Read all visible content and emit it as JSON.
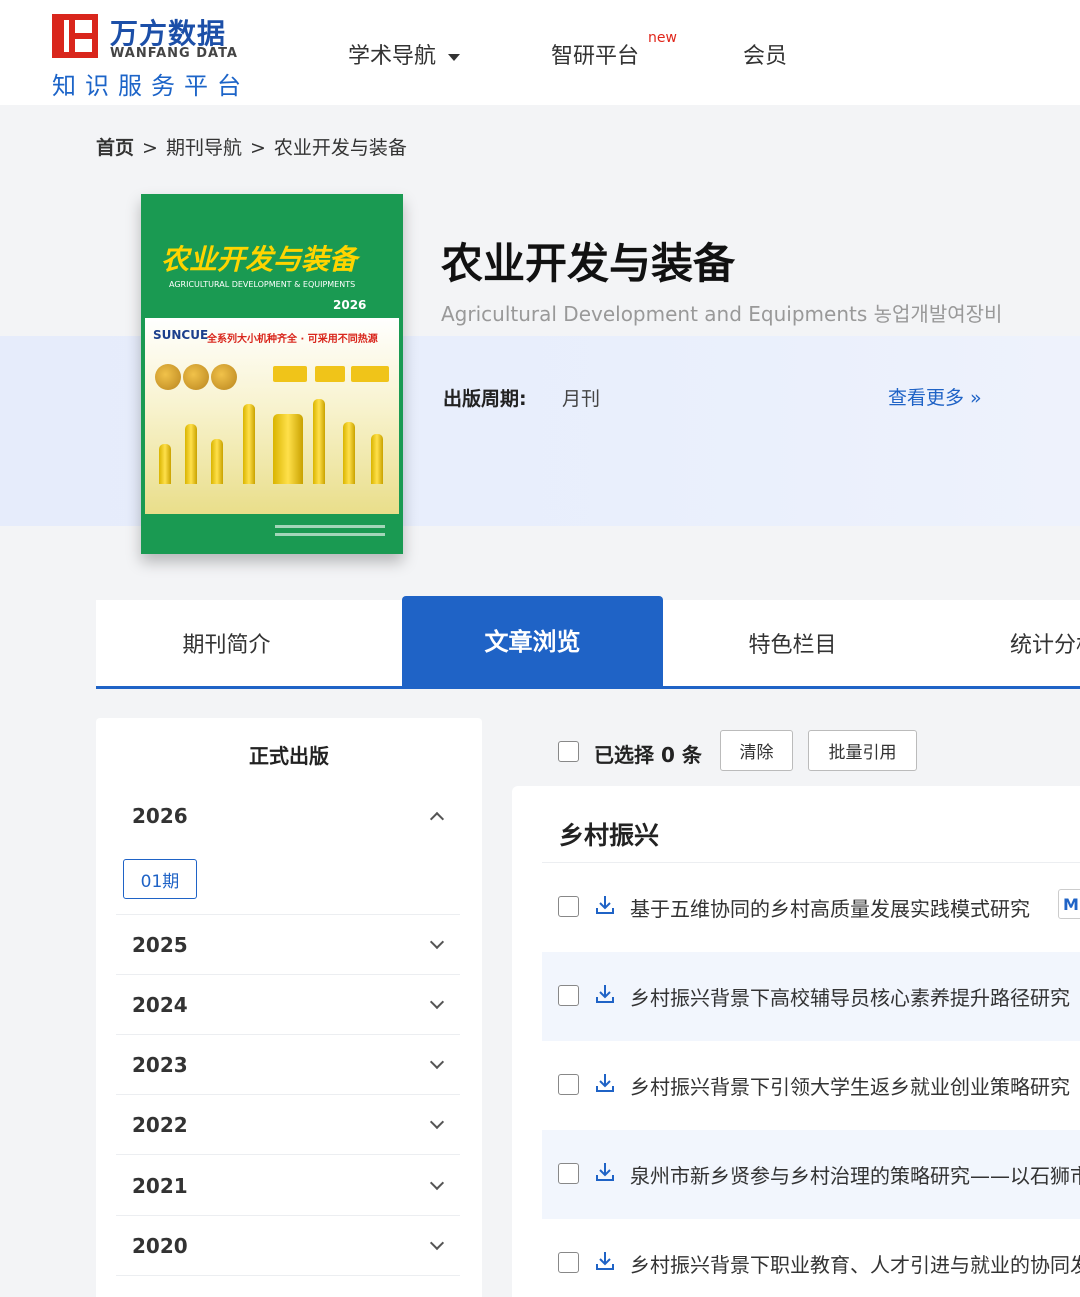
{
  "header": {
    "logo_cn": "万方数据",
    "logo_en": "WANFANG DATA",
    "logo_sub": "知识服务平台",
    "nav": [
      {
        "label": "学术导航"
      },
      {
        "label": "智研平台",
        "badge": "new"
      },
      {
        "label": "会员"
      }
    ]
  },
  "breadcrumb": {
    "home": "首页",
    "sep": ">",
    "level1": "期刊导航",
    "level2": "农业开发与装备"
  },
  "cover": {
    "title": "农业开发与装备",
    "en": "AGRICULTURAL DEVELOPMENT & EQUIPMENTS",
    "year": "2026",
    "brand": "SUNCUE",
    "slogan": "全系列大小机种齐全 · 可采用不同热源"
  },
  "journal": {
    "title": "农业开发与装备",
    "subtitle": "Agricultural Development and Equipments 농업개발여장비",
    "period_label": "出版周期:",
    "period_value": "月刊",
    "more": "查看更多 »"
  },
  "tabs": [
    {
      "label": "期刊简介",
      "active": false
    },
    {
      "label": "文章浏览",
      "active": true
    },
    {
      "label": "特色栏目",
      "active": false
    },
    {
      "label": "统计分析",
      "active": false
    }
  ],
  "sidebar": {
    "title": "正式出版",
    "years": [
      "2026",
      "2025",
      "2024",
      "2023",
      "2022",
      "2021",
      "2020"
    ],
    "expanded_issue": "01期"
  },
  "toolbar": {
    "selected": "已选择 0 条",
    "clear": "清除",
    "batch_cite": "批量引用"
  },
  "section": {
    "title": "乡村振兴",
    "articles": [
      {
        "title": "基于五维协同的乡村高质量发展实践模式研究",
        "badge": "M"
      },
      {
        "title": "乡村振兴背景下高校辅导员核心素养提升路径研究"
      },
      {
        "title": "乡村振兴背景下引领大学生返乡就业创业策略研究"
      },
      {
        "title": "泉州市新乡贤参与乡村治理的策略研究——以石狮市为例"
      },
      {
        "title": "乡村振兴背景下职业教育、人才引进与就业的协同发展研究"
      }
    ]
  },
  "colors": {
    "primary": "#1f63c6",
    "logo_red": "#d9261c",
    "cover_green": "#1a9a52",
    "new_badge": "#e0261b"
  }
}
